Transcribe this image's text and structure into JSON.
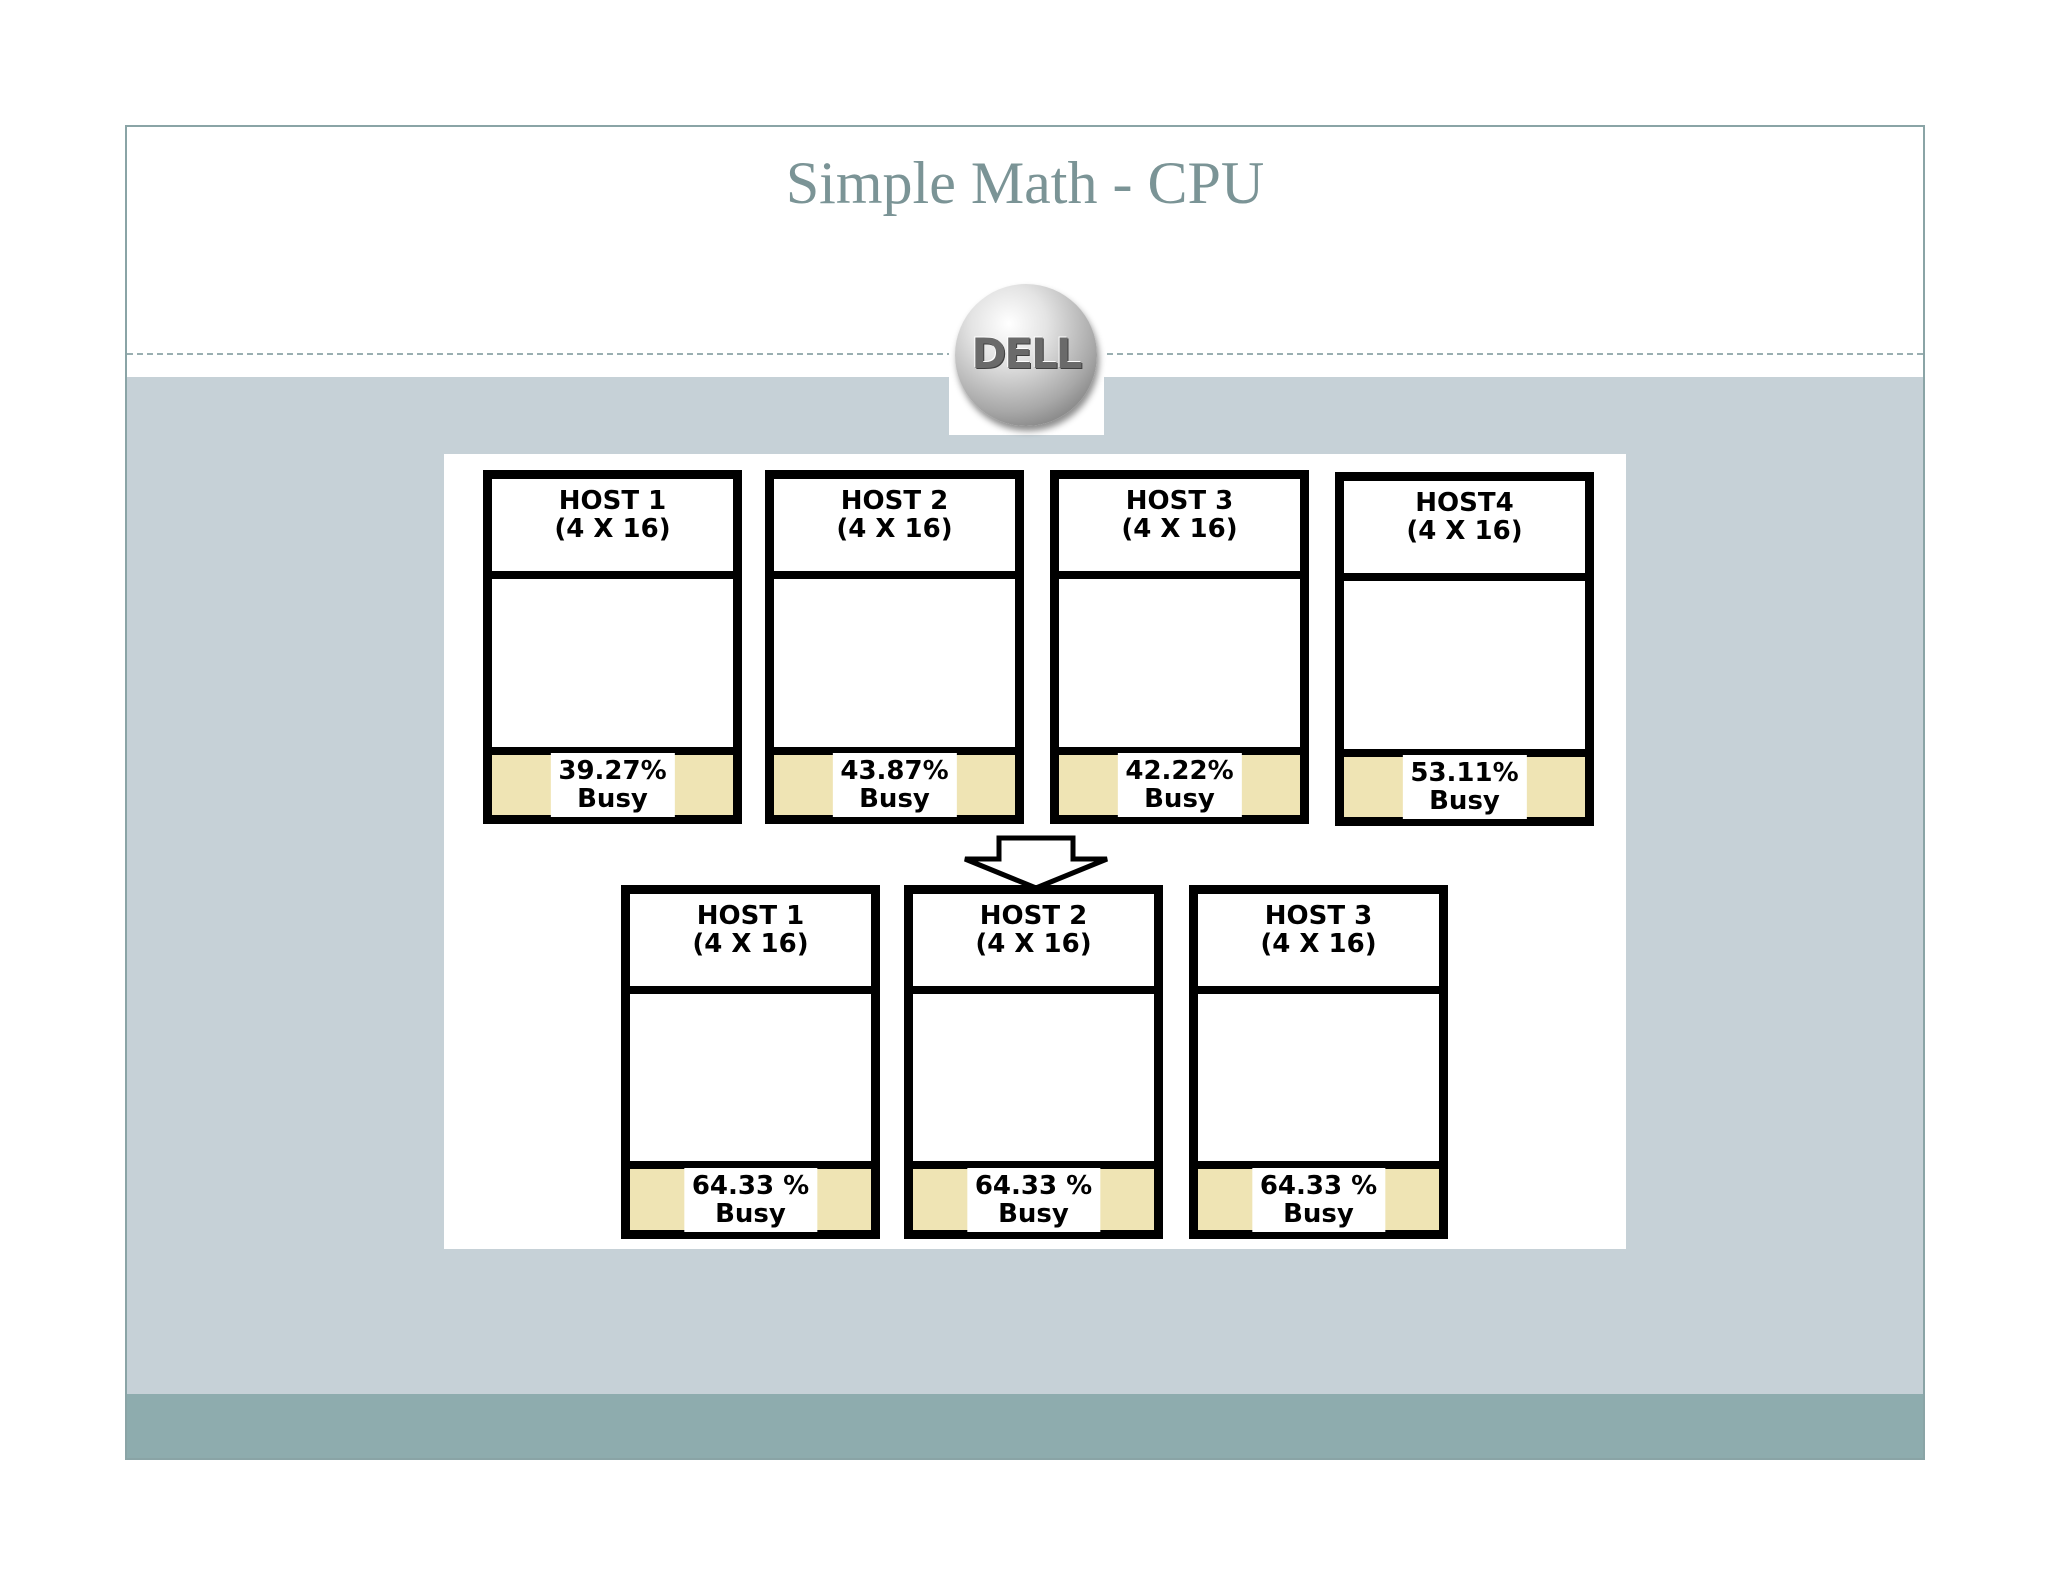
{
  "slide": {
    "title": "Simple Math - CPU"
  },
  "logo": {
    "text": "DELL"
  },
  "before": {
    "hosts": [
      {
        "name": "HOST 1",
        "spec": "(4 X 16)",
        "busy_value": "39.27%",
        "busy_text": "Busy",
        "busy_fraction": 0.3927
      },
      {
        "name": "HOST 2",
        "spec": "(4 X 16)",
        "busy_value": "43.87%",
        "busy_text": "Busy",
        "busy_fraction": 0.4387
      },
      {
        "name": "HOST 3",
        "spec": "(4 X 16)",
        "busy_value": "42.22%",
        "busy_text": "Busy",
        "busy_fraction": 0.4222
      },
      {
        "name": "HOST4",
        "spec": "(4 X 16)",
        "busy_value": "53.11%",
        "busy_text": "Busy",
        "busy_fraction": 0.5311
      }
    ]
  },
  "after": {
    "hosts": [
      {
        "name": "HOST 1",
        "spec": "(4 X 16)",
        "busy_value": "64.33 %",
        "busy_text": "Busy",
        "busy_fraction": 0.6433
      },
      {
        "name": "HOST 2",
        "spec": "(4 X 16)",
        "busy_value": "64.33 %",
        "busy_text": "Busy",
        "busy_fraction": 0.6433
      },
      {
        "name": "HOST 3",
        "spec": "(4 X 16)",
        "busy_value": "64.33 %",
        "busy_text": "Busy",
        "busy_fraction": 0.6433
      }
    ]
  },
  "colors": {
    "content_background": "#c6d1d7",
    "footer_band": "#8eacae",
    "title_text": "#7b9496",
    "busy_fill": "#efe4b4",
    "box_border": "#000000"
  }
}
